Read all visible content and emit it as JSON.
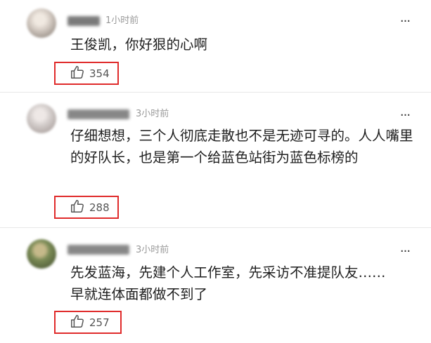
{
  "comments": [
    {
      "time": "1小时前",
      "text": "王俊凯，你好狠的心啊",
      "likes": "354",
      "avatar_colors": [
        "#d8cfc7",
        "#7d746c",
        "#f0e9e1"
      ],
      "name_color": "#5a5a5a"
    },
    {
      "time": "3小时前",
      "text": "仔细想想，三个人彻底走散也不是无迹可寻的。人人嘴里的好队长，也是第一个给蓝色站街为蓝色标榜的",
      "likes": "288",
      "avatar_colors": [
        "#d6d0ce",
        "#9a8f8c",
        "#eee8e6"
      ],
      "name_color": "#6a6a6a"
    },
    {
      "time": "3小时前",
      "text": "先发蓝海，先建个人工作室，先采访不准提队友……早就连体面都做不到了",
      "likes": "257",
      "avatar_colors": [
        "#7a8a55",
        "#3f4a2c",
        "#c6b98a"
      ],
      "name_color": "#6a6a6a"
    }
  ],
  "more_symbol": "···",
  "like_icon": "thumbs-up-icon",
  "highlight_color": "#e02b2b"
}
